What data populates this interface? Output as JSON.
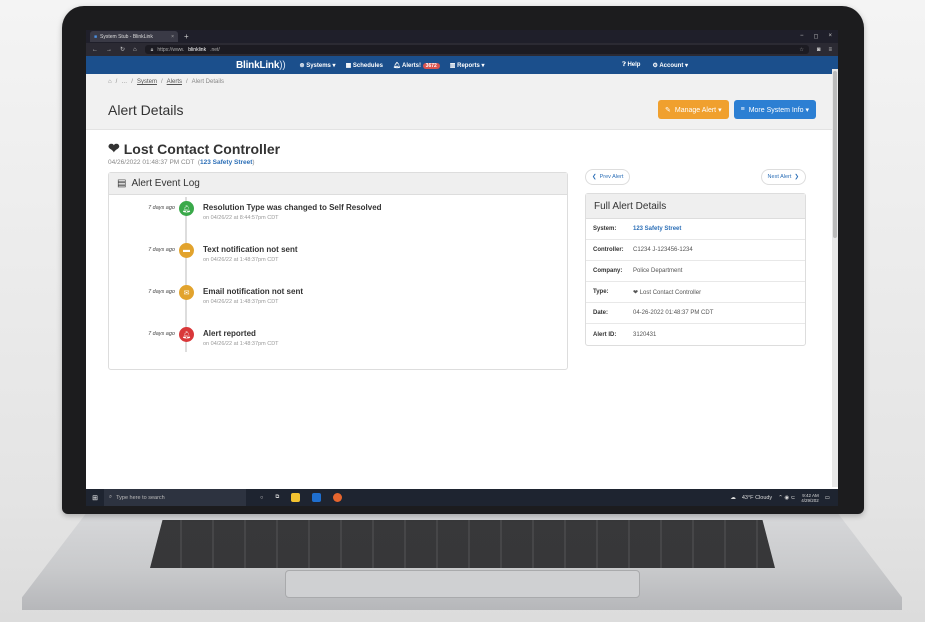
{
  "browser": {
    "tab_title": "System Stub - BlinkLink",
    "tab_close": "×",
    "new_tab": "+",
    "url_prefix": "https://www.",
    "url_domain": "blinklink",
    "url_suffix": ".net/",
    "window_controls": [
      "−",
      "◻",
      "×"
    ]
  },
  "navbar": {
    "brand": "BlinkLink",
    "brand_mark": "))",
    "items": [
      {
        "icon": "radio-icon",
        "label": "Systems ▾"
      },
      {
        "icon": "calendar-icon",
        "label": "Schedules"
      },
      {
        "icon": "bell-icon",
        "label": "Alerts!",
        "badge": "3672"
      },
      {
        "icon": "bar-chart-icon",
        "label": "Reports ▾"
      }
    ],
    "help": "Help",
    "account": "Account ▾"
  },
  "breadcrumb": [
    "…",
    "System",
    "Alerts",
    "Alert Details"
  ],
  "page_title": "Alert Details",
  "buttons": {
    "manage_alert": "Manage Alert ▾",
    "more_info": "More System Info ▾"
  },
  "alert": {
    "title": "Lost Contact Controller",
    "timestamp": "04/26/2022 01:48:37 PM CDT",
    "location": "123 Safety Street"
  },
  "event_log": {
    "title": "Alert Event Log",
    "events": [
      {
        "ago": "7 days ago",
        "title": "Resolution Type was changed to Self Resolved",
        "sub": "on 04/26/22 at 8:44:57pm CDT",
        "color": "#3aa94a"
      },
      {
        "ago": "7 days ago",
        "title": "Text notification not sent",
        "sub": "on 04/26/22 at 1:48:37pm CDT",
        "color": "#e2a32d"
      },
      {
        "ago": "7 days ago",
        "title": "Email notification not sent",
        "sub": "on 04/26/22 at 1:48:37pm CDT",
        "color": "#e2a32d"
      },
      {
        "ago": "7 days ago",
        "title": "Alert reported",
        "sub": "on 04/26/22 at 1:48:37pm CDT",
        "color": "#d9383a"
      }
    ]
  },
  "pager": {
    "prev": "Prev Alert",
    "next": "Next Alert"
  },
  "details": {
    "title": "Full Alert Details",
    "rows": [
      {
        "key": "System:",
        "value": "123 Safety Street"
      },
      {
        "key": "Controller:",
        "value": "C1234 J-123456-1234"
      },
      {
        "key": "Company:",
        "value": "Police Department"
      },
      {
        "key": "Type:",
        "value": "Lost Contact Controller"
      },
      {
        "key": "Date:",
        "value": "04-26-2022 01:48:37 PM CDT"
      },
      {
        "key": "Alert ID:",
        "value": "3120431"
      }
    ]
  },
  "taskbar": {
    "search_placeholder": "Type here to search",
    "weather": "43°F Cloudy",
    "time": "9:42 AM",
    "date": "4/29/202"
  }
}
